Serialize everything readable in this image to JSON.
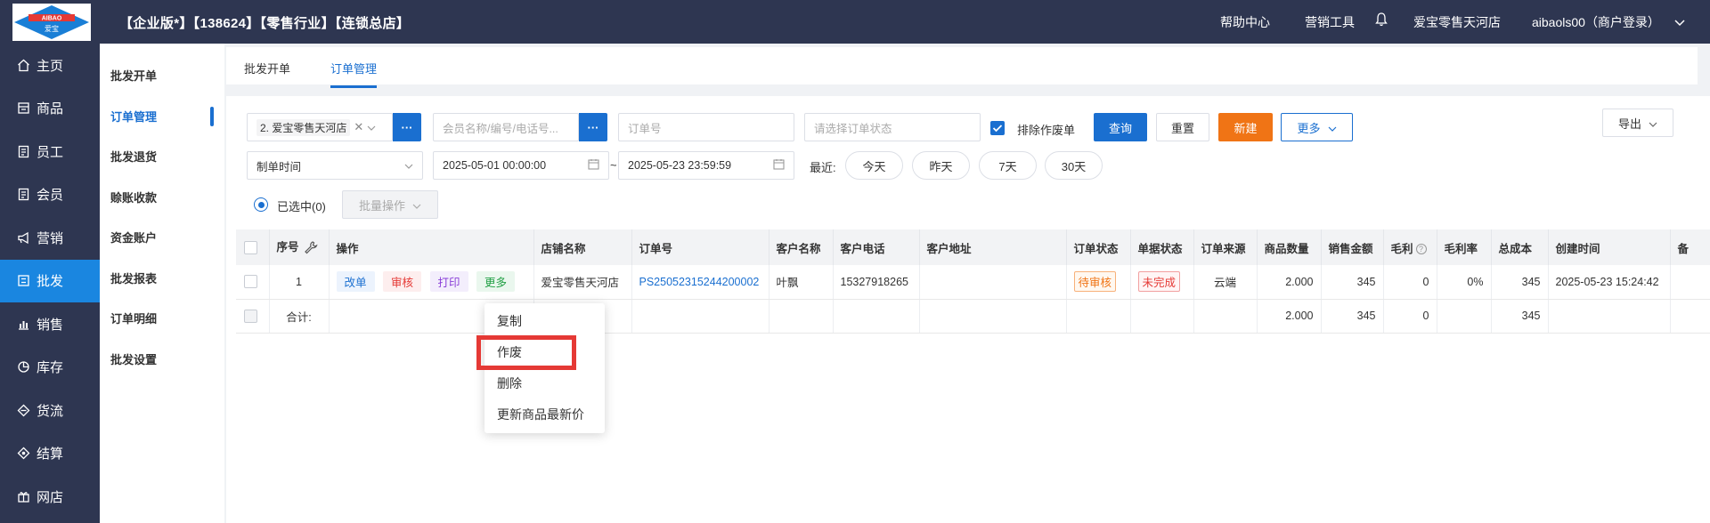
{
  "header": {
    "logo_text_top": "AIBAO",
    "logo_text_bottom": "爱宝",
    "title": "【企业版*】【138624】【零售行业】【连锁总店】",
    "help": "帮助中心",
    "marketing": "营销工具",
    "bell_icon": "bell-icon",
    "store": "爱宝零售天河店",
    "user": "aibaols00（商户登录）"
  },
  "sidebar": {
    "items": [
      {
        "label": "主页",
        "icon": "home-icon"
      },
      {
        "label": "商品",
        "icon": "goods-icon"
      },
      {
        "label": "员工",
        "icon": "staff-icon"
      },
      {
        "label": "会员",
        "icon": "member-icon"
      },
      {
        "label": "营销",
        "icon": "megaphone-icon"
      },
      {
        "label": "批发",
        "icon": "wholesale-icon"
      },
      {
        "label": "销售",
        "icon": "chart-icon"
      },
      {
        "label": "库存",
        "icon": "pie-icon"
      },
      {
        "label": "货流",
        "icon": "flow-icon"
      },
      {
        "label": "结算",
        "icon": "settle-icon"
      },
      {
        "label": "网店",
        "icon": "gift-icon"
      }
    ],
    "active_index": 5
  },
  "subnav": {
    "items": [
      "批发开单",
      "订单管理",
      "批发退货",
      "赊账收款",
      "资金账户",
      "批发报表",
      "订单明细",
      "批发设置"
    ],
    "active_index": 1
  },
  "tabs": [
    {
      "label": "批发开单"
    },
    {
      "label": "订单管理"
    }
  ],
  "filters": {
    "store_value": "2. 爱宝零售天河店",
    "more_dots": "···",
    "member_placeholder": "会员名称/编号/电话号...",
    "order_no_placeholder": "订单号",
    "status_placeholder": "请选择订单状态",
    "exclude_void_label": "排除作废单",
    "query": "查询",
    "reset": "重置",
    "new": "新建",
    "more": "更多",
    "export": "导出",
    "date_type": "制单时间",
    "date_start": "2025-05-01 00:00:00",
    "date_sep": "~",
    "date_end": "2025-05-23 23:59:59",
    "recent_label": "最近:",
    "quick": [
      "今天",
      "昨天",
      "7天",
      "30天"
    ],
    "selected_label": "已选中(0)",
    "batch": "批量操作"
  },
  "table": {
    "headers": [
      "序号",
      "操作",
      "店铺名称",
      "订单号",
      "客户名称",
      "客户电话",
      "客户地址",
      "订单状态",
      "单据状态",
      "订单来源",
      "商品数量",
      "销售金额",
      "毛利",
      "毛利率",
      "总成本",
      "创建时间",
      "备"
    ],
    "row": {
      "index": "1",
      "actions": [
        "改单",
        "审核",
        "打印",
        "更多"
      ],
      "store": "爱宝零售天河店",
      "order_no": "PS25052315244200002",
      "customer": "叶飘",
      "phone": "15327918265",
      "address": "",
      "order_status": "待审核",
      "doc_status": "未完成",
      "source": "云端",
      "qty": "2.000",
      "amount": "345",
      "profit": "0",
      "profit_rate": "0%",
      "cost": "345",
      "created": "2025-05-23 15:24:42"
    },
    "total": {
      "label": "合计:",
      "qty": "2.000",
      "amount": "345",
      "profit": "0",
      "cost": "345"
    }
  },
  "context_menu": {
    "items": [
      "复制",
      "作废",
      "删除",
      "更新商品最新价"
    ],
    "highlighted_index": 1
  },
  "colors": {
    "topbar": "#2e3651",
    "accent": "#1a6fd0",
    "active_side": "#1a86e0",
    "orange": "#f07415",
    "highlight": "#e53935"
  }
}
